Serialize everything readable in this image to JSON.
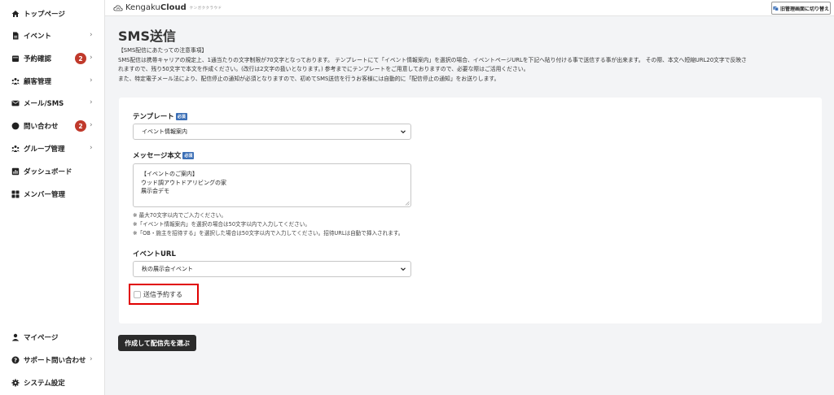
{
  "sidebar": {
    "items": [
      {
        "label": "トップページ",
        "icon": "home-icon"
      },
      {
        "label": "イベント",
        "icon": "document-icon"
      },
      {
        "label": "予約確認",
        "icon": "calendar-icon",
        "badge": "2"
      },
      {
        "label": "顧客管理",
        "icon": "people-icon"
      },
      {
        "label": "メール/SMS",
        "icon": "mail-icon"
      },
      {
        "label": "問い合わせ",
        "icon": "chat-icon",
        "badge": "2"
      },
      {
        "label": "グループ管理",
        "icon": "group-icon"
      },
      {
        "label": "ダッシュボード",
        "icon": "chart-icon"
      },
      {
        "label": "メンバー管理",
        "icon": "grid-icon"
      }
    ],
    "bottom_items": [
      {
        "label": "マイページ",
        "icon": "user-icon"
      },
      {
        "label": "サポート問い合わせ",
        "icon": "question-icon"
      },
      {
        "label": "システム設定",
        "icon": "gear-icon"
      }
    ],
    "chevron": "›"
  },
  "topbar": {
    "logo_text": "Kengaku",
    "logo_bold": "Cloud",
    "logo_sub": "ケンガククラウド",
    "switch_label": "旧管理画面に切り替え"
  },
  "page": {
    "title": "SMS送信",
    "notice": [
      "【SMS配信にあたっての注意事項】",
      "SMS配信は携帯キャリアの規定上、1通当たりの文字制限が70文字となっております。 テンプレートにて「イベント情報案内」を選択の場合、イベントページURLを下記へ貼り付ける事で送信する事が出来ます。 その際、本文へ短縮URL20文字で反映さ",
      "れますので、残り50文字で本文を作成ください。(改行は2文字の扱いとなります。) 参考までにテンプレートをご用意しておりますので、必要な際はご活用ください。",
      "また、特定電子メール法により、配信停止の通知が必須となりますので、初めてSMS送信を行うお客様には自動的に「配信停止の通知」をお送りします。"
    ]
  },
  "form": {
    "required_tag": "必須",
    "template_label": "テンプレート",
    "template_value": "イベント情報案内",
    "message_label": "メッセージ本文",
    "message_lines": [
      "【イベントのご案内】",
      "ウッド調アウトドアリビングの家",
      "展示会デモ"
    ],
    "hints": [
      "※ 最大70文字以内でご入力ください。",
      "※「イベント情報案内」を選択の場合は50文字以内で入力してください。",
      "※「OB・施主を招待する」を選択した場合は50文字以内で入力してください。招待URLは自動で挿入されます。"
    ],
    "event_url_label": "イベントURL",
    "event_url_value": "秋の展示会イベント",
    "schedule_label": "送信予約する",
    "schedule_checked": false,
    "submit_label": "作成して配信先を選ぶ"
  }
}
